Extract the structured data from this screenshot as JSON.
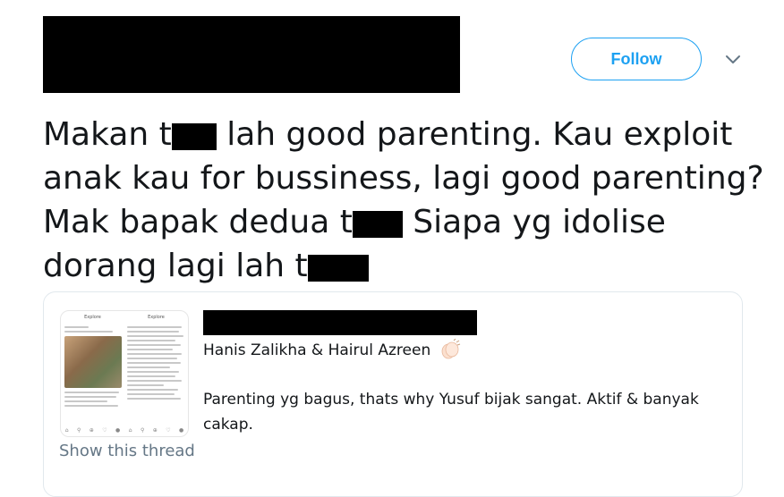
{
  "header": {
    "follow_label": "Follow"
  },
  "tweet": {
    "lines": [
      {
        "before": "Makan t",
        "after": " lah good parenting. Kau exploit"
      },
      {
        "text": "anak kau for bussiness, lagi good parenting?"
      },
      {
        "before": "Mak bapak dedua t",
        "after": " Siapa yg idolise"
      },
      {
        "before": "dorang lagi lah t",
        "after": ""
      }
    ]
  },
  "quote": {
    "thumbnail_tabs": [
      "Explore",
      "Explore"
    ],
    "author_line": "Hanis Zalikha & Hairul Azreen",
    "author_emoji": "clapping-hands",
    "body_line1": "Parenting yg bagus, thats why Yusuf bijak sangat. Aktif & banyak",
    "body_line2": "cakap."
  },
  "show_thread_label": "Show this thread",
  "colors": {
    "accent": "#1da1f2",
    "text": "#14171a",
    "muted": "#657786",
    "border": "#e1e8ed",
    "redaction": "#000000"
  }
}
